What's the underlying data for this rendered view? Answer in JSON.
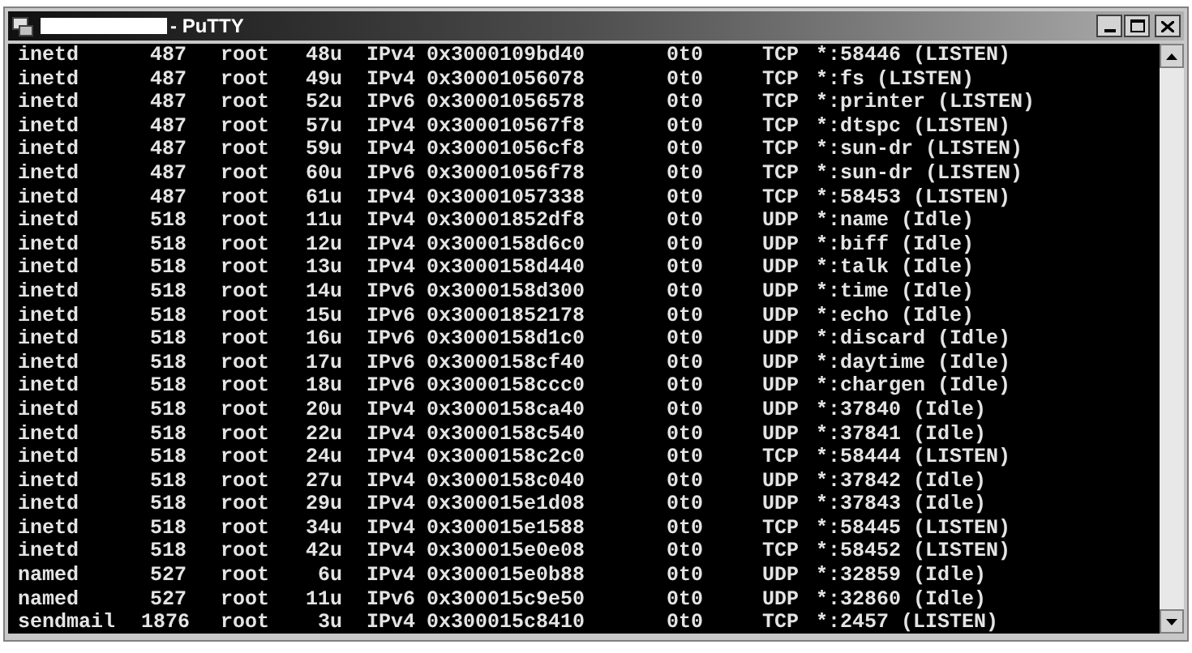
{
  "window": {
    "title": "- PuTTY"
  },
  "terminal": {
    "lines": [
      [
        "inetd",
        "487",
        "root",
        "48u",
        "IPv4",
        "0x3000109bd40",
        "0t0",
        "TCP",
        "*:58446 (LISTEN)"
      ],
      [
        "inetd",
        "487",
        "root",
        "49u",
        "IPv4",
        "0x30001056078",
        "0t0",
        "TCP",
        "*:fs (LISTEN)"
      ],
      [
        "inetd",
        "487",
        "root",
        "52u",
        "IPv6",
        "0x30001056578",
        "0t0",
        "TCP",
        "*:printer (LISTEN)"
      ],
      [
        "inetd",
        "487",
        "root",
        "57u",
        "IPv4",
        "0x300010567f8",
        "0t0",
        "TCP",
        "*:dtspc (LISTEN)"
      ],
      [
        "inetd",
        "487",
        "root",
        "59u",
        "IPv4",
        "0x30001056cf8",
        "0t0",
        "TCP",
        "*:sun-dr (LISTEN)"
      ],
      [
        "inetd",
        "487",
        "root",
        "60u",
        "IPv6",
        "0x30001056f78",
        "0t0",
        "TCP",
        "*:sun-dr (LISTEN)"
      ],
      [
        "inetd",
        "487",
        "root",
        "61u",
        "IPv4",
        "0x30001057338",
        "0t0",
        "TCP",
        "*:58453 (LISTEN)"
      ],
      [
        "inetd",
        "518",
        "root",
        "11u",
        "IPv4",
        "0x30001852df8",
        "0t0",
        "UDP",
        "*:name (Idle)"
      ],
      [
        "inetd",
        "518",
        "root",
        "12u",
        "IPv4",
        "0x3000158d6c0",
        "0t0",
        "UDP",
        "*:biff (Idle)"
      ],
      [
        "inetd",
        "518",
        "root",
        "13u",
        "IPv4",
        "0x3000158d440",
        "0t0",
        "UDP",
        "*:talk (Idle)"
      ],
      [
        "inetd",
        "518",
        "root",
        "14u",
        "IPv6",
        "0x3000158d300",
        "0t0",
        "UDP",
        "*:time (Idle)"
      ],
      [
        "inetd",
        "518",
        "root",
        "15u",
        "IPv6",
        "0x30001852178",
        "0t0",
        "UDP",
        "*:echo (Idle)"
      ],
      [
        "inetd",
        "518",
        "root",
        "16u",
        "IPv6",
        "0x3000158d1c0",
        "0t0",
        "UDP",
        "*:discard (Idle)"
      ],
      [
        "inetd",
        "518",
        "root",
        "17u",
        "IPv6",
        "0x3000158cf40",
        "0t0",
        "UDP",
        "*:daytime (Idle)"
      ],
      [
        "inetd",
        "518",
        "root",
        "18u",
        "IPv6",
        "0x3000158ccc0",
        "0t0",
        "UDP",
        "*:chargen (Idle)"
      ],
      [
        "inetd",
        "518",
        "root",
        "20u",
        "IPv4",
        "0x3000158ca40",
        "0t0",
        "UDP",
        "*:37840 (Idle)"
      ],
      [
        "inetd",
        "518",
        "root",
        "22u",
        "IPv4",
        "0x3000158c540",
        "0t0",
        "UDP",
        "*:37841 (Idle)"
      ],
      [
        "inetd",
        "518",
        "root",
        "24u",
        "IPv4",
        "0x3000158c2c0",
        "0t0",
        "TCP",
        "*:58444 (LISTEN)"
      ],
      [
        "inetd",
        "518",
        "root",
        "27u",
        "IPv4",
        "0x3000158c040",
        "0t0",
        "UDP",
        "*:37842 (Idle)"
      ],
      [
        "inetd",
        "518",
        "root",
        "29u",
        "IPv4",
        "0x300015e1d08",
        "0t0",
        "UDP",
        "*:37843 (Idle)"
      ],
      [
        "inetd",
        "518",
        "root",
        "34u",
        "IPv4",
        "0x300015e1588",
        "0t0",
        "TCP",
        "*:58445 (LISTEN)"
      ],
      [
        "inetd",
        "518",
        "root",
        "42u",
        "IPv4",
        "0x300015e0e08",
        "0t0",
        "TCP",
        "*:58452 (LISTEN)"
      ],
      [
        "named",
        "527",
        "root",
        "6u",
        "IPv4",
        "0x300015e0b88",
        "0t0",
        "UDP",
        "*:32859 (Idle)"
      ],
      [
        "named",
        "527",
        "root",
        "11u",
        "IPv6",
        "0x300015c9e50",
        "0t0",
        "UDP",
        "*:32860 (Idle)"
      ],
      [
        "sendmail",
        "1876",
        "root",
        "3u",
        "IPv4",
        "0x300015c8410",
        "0t0",
        "TCP",
        "*:2457 (LISTEN)"
      ]
    ]
  }
}
